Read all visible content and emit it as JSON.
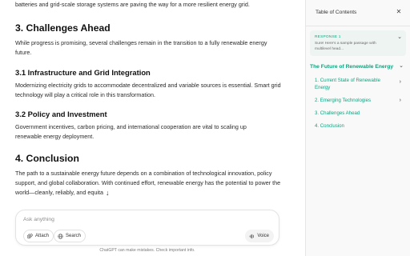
{
  "article": {
    "intro_tail": "batteries and grid-scale storage systems are paving the way for a more resilient energy grid.",
    "sections": [
      {
        "heading": "3. Challenges Ahead",
        "body": "While progress is promising, several challenges remain in the transition to a fully renewable energy future."
      },
      {
        "heading": "3.1 Infrastructure and Grid Integration",
        "body": "Modernizing electricity grids to accommodate decentralized and variable sources is essential. Smart grid technology will play a critical role in this transformation."
      },
      {
        "heading": "3.2 Policy and Investment",
        "body": "Government incentives, carbon pricing, and international cooperation are vital to scaling up renewable energy deployment."
      },
      {
        "heading": "4. Conclusion",
        "body": "The path to a sustainable energy future depends on a combination of technological innovation, policy support, and global collaboration. With continued effort, renewable energy has the potential to power the world—cleanly, reliably, and equita"
      }
    ]
  },
  "composer": {
    "placeholder": "Ask anything",
    "attach_label": "Attach",
    "search_label": "Search",
    "voice_label": "Voice"
  },
  "disclaimer": "ChatGPT can make mistakes. Check important info.",
  "toc": {
    "title": "Table of Contents",
    "response_label": "RESPONSE 1",
    "response_snippet": "Sure! Here's a sample passage with multilevel head...",
    "root": "The Future of Renewable Energy",
    "items": [
      "1. Current State of Renewable Energy",
      "2. Emerging Technologies",
      "3. Challenges Ahead",
      "4. Conclusion"
    ]
  },
  "icons": {
    "close": "close-icon",
    "response_chevron": "chevron-up-icon",
    "root_chevron": "chevron-down-icon",
    "item_chevron": "chevron-right-icon",
    "attach": "paperclip-icon",
    "search": "globe-icon",
    "voice": "waveform-icon",
    "scroll_down": "arrow-down-icon"
  },
  "colors": {
    "accent": "#10a37f",
    "panel_bg": "#f9f9f9",
    "response_bg": "#eef4f1"
  }
}
